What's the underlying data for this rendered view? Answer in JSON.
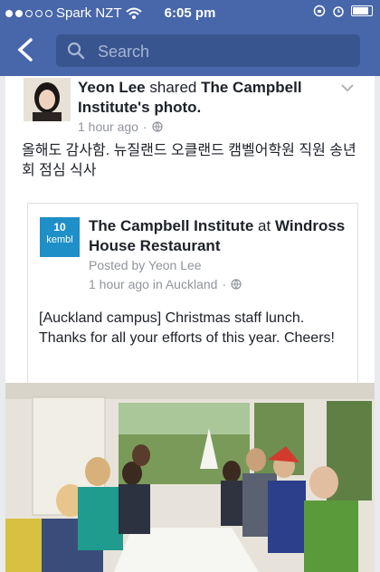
{
  "status_bar": {
    "carrier": "Spark NZT",
    "time": "6:05 pm"
  },
  "search": {
    "placeholder": "Search"
  },
  "post": {
    "author": "Yeon Lee",
    "shared_text": "shared",
    "page_name": "The Campbell Institute",
    "photo_suffix": "'s photo.",
    "time": "1 hour ago",
    "message": "올해도 감사함. 뉴질랜드 오클랜드 캠벨어학원 직원 송년회 점심 식사",
    "shared": {
      "page_name": "The Campbell Institute",
      "at_text": "at",
      "place": "Windross House Restaurant",
      "posted_by": "Posted by Yeon Lee",
      "time_location": "1 hour ago in Auckland",
      "text": "[Auckland campus] Christmas  staff lunch. Thanks for all your efforts of this year. Cheers!",
      "logo_number": "10",
      "logo_text": "kembl"
    }
  },
  "icons": [
    "back-icon",
    "search-icon",
    "globe-icon",
    "chevron-down-icon",
    "wifi-icon",
    "battery-icon",
    "alarm-icon",
    "rotation-lock-icon"
  ]
}
